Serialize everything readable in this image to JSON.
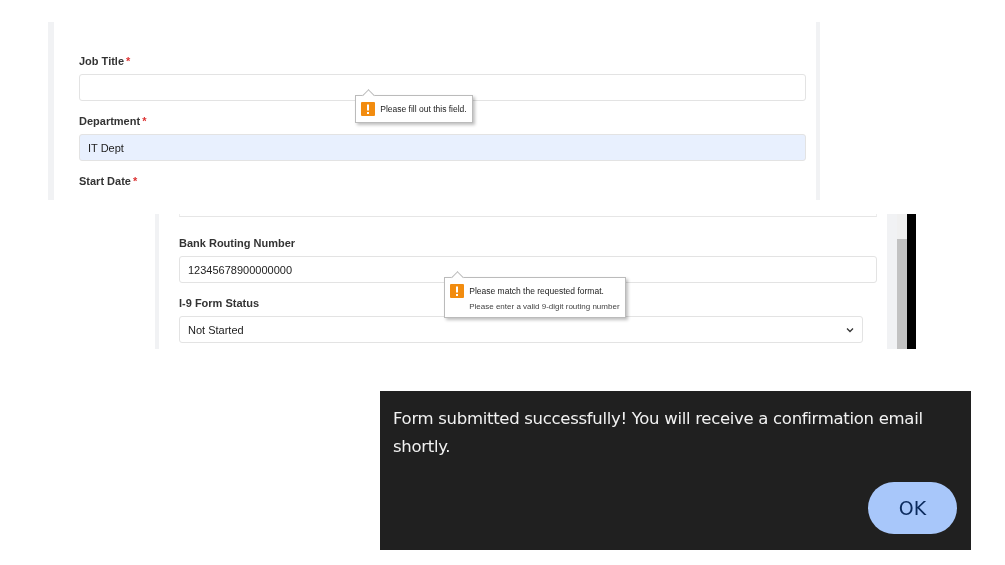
{
  "panels": [
    {
      "fields": [
        {
          "kind": "input",
          "label": "Job Title",
          "required_mark": "*",
          "autofilled": false,
          "tooltip": {
            "message": "Please fill out this field."
          }
        },
        {
          "kind": "input",
          "label": "Department",
          "required_mark": "*",
          "value": "IT Dept",
          "autofilled": true
        },
        {
          "kind": "label",
          "label": "Start Date",
          "required_mark": "*"
        }
      ]
    },
    {
      "fields": [
        {
          "kind": "input",
          "label": "Bank Routing Number",
          "value": "12345678900000000",
          "autofilled": false,
          "tooltip": {
            "message": "Please match the requested format.",
            "detail": "Please enter a valid 9-digit routing number"
          }
        },
        {
          "kind": "select",
          "label": "I-9 Form Status",
          "value": "Not Started",
          "autofilled": false
        }
      ]
    }
  ],
  "dialog": {
    "message": "Form submitted successfully! You will receive a confirmation email shortly.",
    "buttons": [
      "OK"
    ]
  }
}
